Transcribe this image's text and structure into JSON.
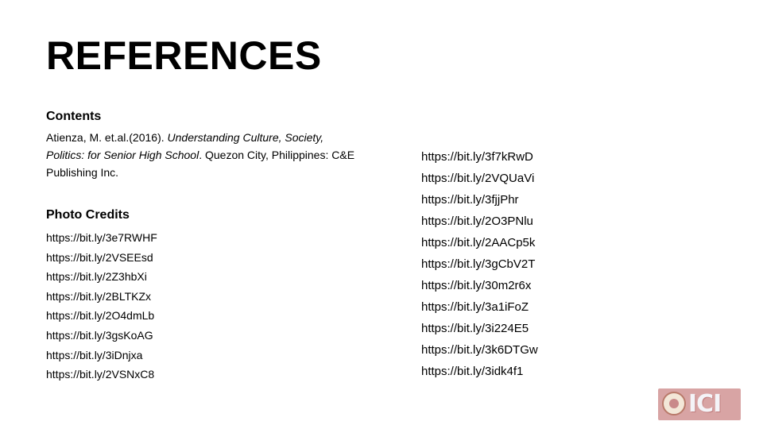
{
  "slide": {
    "title": "REFERENCES"
  },
  "contents": {
    "heading": "Contents",
    "citation": {
      "authors": "Atienza, M. et.al.(2016). ",
      "book_title": "Understanding Culture, Society, Politics: for Senior High School",
      "publisher": ". Quezon City, Philippines: C&E Publishing Inc."
    }
  },
  "photo_credits": {
    "heading": "Photo Credits",
    "left_links": [
      "https://bit.ly/3e7RWHF",
      "https://bit.ly/2VSEEsd",
      "https://bit.ly/2Z3hbXi",
      "https://bit.ly/2BLTKZx",
      "https://bit.ly/2O4dmLb",
      "https://bit.ly/3gsKoAG",
      "https://bit.ly/3iDnjxa",
      "https://bit.ly/2VSNxC8"
    ],
    "right_links": [
      "https://bit.ly/3f7kRwD",
      "https://bit.ly/2VQUaVi",
      "https://bit.ly/3fjjPhr",
      "https://bit.ly/2O3PNlu",
      "https://bit.ly/2AACp5k",
      "https://bit.ly/3gCbV2T",
      "https://bit.ly/30m2r6x",
      "https://bit.ly/3a1iFoZ",
      "https://bit.ly/3i224E5",
      "https://bit.ly/3k6DTGw",
      "https://bit.ly/3idk4f1"
    ]
  },
  "logo": {
    "text": "ICI",
    "icon": "seal-icon"
  }
}
